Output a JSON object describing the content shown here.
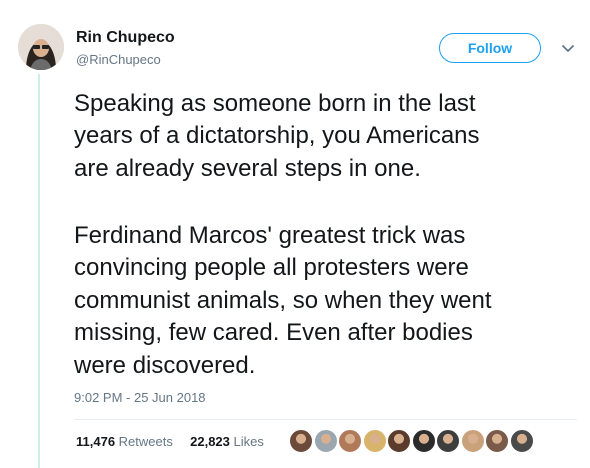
{
  "author": {
    "name": "Rin Chupeco",
    "handle": "@RinChupeco",
    "avatar_icon": "profile-photo"
  },
  "follow_label": "Follow",
  "more_icon": "chevron-down-icon",
  "tweet": {
    "paragraph1": "Speaking as someone born in the last\nyears of a dictatorship, you Americans\nare already several steps in one.",
    "paragraph2": "Ferdinand Marcos' greatest trick was\nconvincing people all protesters were\ncommunist animals, so when they went\nmissing, few cared. Even after bodies\nwere discovered."
  },
  "timestamp": "9:02 PM - 25 Jun 2018",
  "stats": {
    "retweets_count": "11,476",
    "retweets_label": "Retweets",
    "likes_count": "22,823",
    "likes_label": "Likes"
  },
  "liker_colors": [
    "#6b4a3a",
    "#9aa7b0",
    "#b07a5a",
    "#d8b36a",
    "#5a3b2c",
    "#2b2b2b",
    "#3d3d3d",
    "#c9a27c",
    "#7a5a48",
    "#4a4a4a"
  ],
  "colors": {
    "accent": "#1da1f2",
    "thread": "#cdeee2",
    "muted": "#657786"
  }
}
